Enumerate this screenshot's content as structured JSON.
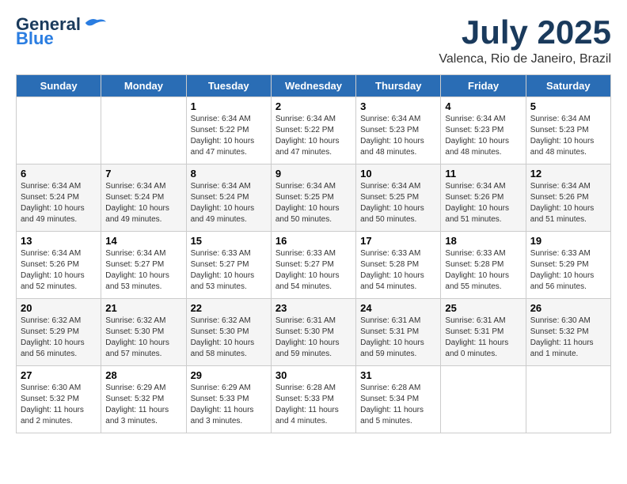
{
  "header": {
    "logo_line1": "General",
    "logo_line2": "Blue",
    "title": "July 2025",
    "subtitle": "Valenca, Rio de Janeiro, Brazil"
  },
  "weekdays": [
    "Sunday",
    "Monday",
    "Tuesday",
    "Wednesday",
    "Thursday",
    "Friday",
    "Saturday"
  ],
  "weeks": [
    [
      {
        "day": "",
        "info": ""
      },
      {
        "day": "",
        "info": ""
      },
      {
        "day": "1",
        "info": "Sunrise: 6:34 AM\nSunset: 5:22 PM\nDaylight: 10 hours\nand 47 minutes."
      },
      {
        "day": "2",
        "info": "Sunrise: 6:34 AM\nSunset: 5:22 PM\nDaylight: 10 hours\nand 47 minutes."
      },
      {
        "day": "3",
        "info": "Sunrise: 6:34 AM\nSunset: 5:23 PM\nDaylight: 10 hours\nand 48 minutes."
      },
      {
        "day": "4",
        "info": "Sunrise: 6:34 AM\nSunset: 5:23 PM\nDaylight: 10 hours\nand 48 minutes."
      },
      {
        "day": "5",
        "info": "Sunrise: 6:34 AM\nSunset: 5:23 PM\nDaylight: 10 hours\nand 48 minutes."
      }
    ],
    [
      {
        "day": "6",
        "info": "Sunrise: 6:34 AM\nSunset: 5:24 PM\nDaylight: 10 hours\nand 49 minutes."
      },
      {
        "day": "7",
        "info": "Sunrise: 6:34 AM\nSunset: 5:24 PM\nDaylight: 10 hours\nand 49 minutes."
      },
      {
        "day": "8",
        "info": "Sunrise: 6:34 AM\nSunset: 5:24 PM\nDaylight: 10 hours\nand 49 minutes."
      },
      {
        "day": "9",
        "info": "Sunrise: 6:34 AM\nSunset: 5:25 PM\nDaylight: 10 hours\nand 50 minutes."
      },
      {
        "day": "10",
        "info": "Sunrise: 6:34 AM\nSunset: 5:25 PM\nDaylight: 10 hours\nand 50 minutes."
      },
      {
        "day": "11",
        "info": "Sunrise: 6:34 AM\nSunset: 5:26 PM\nDaylight: 10 hours\nand 51 minutes."
      },
      {
        "day": "12",
        "info": "Sunrise: 6:34 AM\nSunset: 5:26 PM\nDaylight: 10 hours\nand 51 minutes."
      }
    ],
    [
      {
        "day": "13",
        "info": "Sunrise: 6:34 AM\nSunset: 5:26 PM\nDaylight: 10 hours\nand 52 minutes."
      },
      {
        "day": "14",
        "info": "Sunrise: 6:34 AM\nSunset: 5:27 PM\nDaylight: 10 hours\nand 53 minutes."
      },
      {
        "day": "15",
        "info": "Sunrise: 6:33 AM\nSunset: 5:27 PM\nDaylight: 10 hours\nand 53 minutes."
      },
      {
        "day": "16",
        "info": "Sunrise: 6:33 AM\nSunset: 5:27 PM\nDaylight: 10 hours\nand 54 minutes."
      },
      {
        "day": "17",
        "info": "Sunrise: 6:33 AM\nSunset: 5:28 PM\nDaylight: 10 hours\nand 54 minutes."
      },
      {
        "day": "18",
        "info": "Sunrise: 6:33 AM\nSunset: 5:28 PM\nDaylight: 10 hours\nand 55 minutes."
      },
      {
        "day": "19",
        "info": "Sunrise: 6:33 AM\nSunset: 5:29 PM\nDaylight: 10 hours\nand 56 minutes."
      }
    ],
    [
      {
        "day": "20",
        "info": "Sunrise: 6:32 AM\nSunset: 5:29 PM\nDaylight: 10 hours\nand 56 minutes."
      },
      {
        "day": "21",
        "info": "Sunrise: 6:32 AM\nSunset: 5:30 PM\nDaylight: 10 hours\nand 57 minutes."
      },
      {
        "day": "22",
        "info": "Sunrise: 6:32 AM\nSunset: 5:30 PM\nDaylight: 10 hours\nand 58 minutes."
      },
      {
        "day": "23",
        "info": "Sunrise: 6:31 AM\nSunset: 5:30 PM\nDaylight: 10 hours\nand 59 minutes."
      },
      {
        "day": "24",
        "info": "Sunrise: 6:31 AM\nSunset: 5:31 PM\nDaylight: 10 hours\nand 59 minutes."
      },
      {
        "day": "25",
        "info": "Sunrise: 6:31 AM\nSunset: 5:31 PM\nDaylight: 11 hours\nand 0 minutes."
      },
      {
        "day": "26",
        "info": "Sunrise: 6:30 AM\nSunset: 5:32 PM\nDaylight: 11 hours\nand 1 minute."
      }
    ],
    [
      {
        "day": "27",
        "info": "Sunrise: 6:30 AM\nSunset: 5:32 PM\nDaylight: 11 hours\nand 2 minutes."
      },
      {
        "day": "28",
        "info": "Sunrise: 6:29 AM\nSunset: 5:32 PM\nDaylight: 11 hours\nand 3 minutes."
      },
      {
        "day": "29",
        "info": "Sunrise: 6:29 AM\nSunset: 5:33 PM\nDaylight: 11 hours\nand 3 minutes."
      },
      {
        "day": "30",
        "info": "Sunrise: 6:28 AM\nSunset: 5:33 PM\nDaylight: 11 hours\nand 4 minutes."
      },
      {
        "day": "31",
        "info": "Sunrise: 6:28 AM\nSunset: 5:34 PM\nDaylight: 11 hours\nand 5 minutes."
      },
      {
        "day": "",
        "info": ""
      },
      {
        "day": "",
        "info": ""
      }
    ]
  ]
}
